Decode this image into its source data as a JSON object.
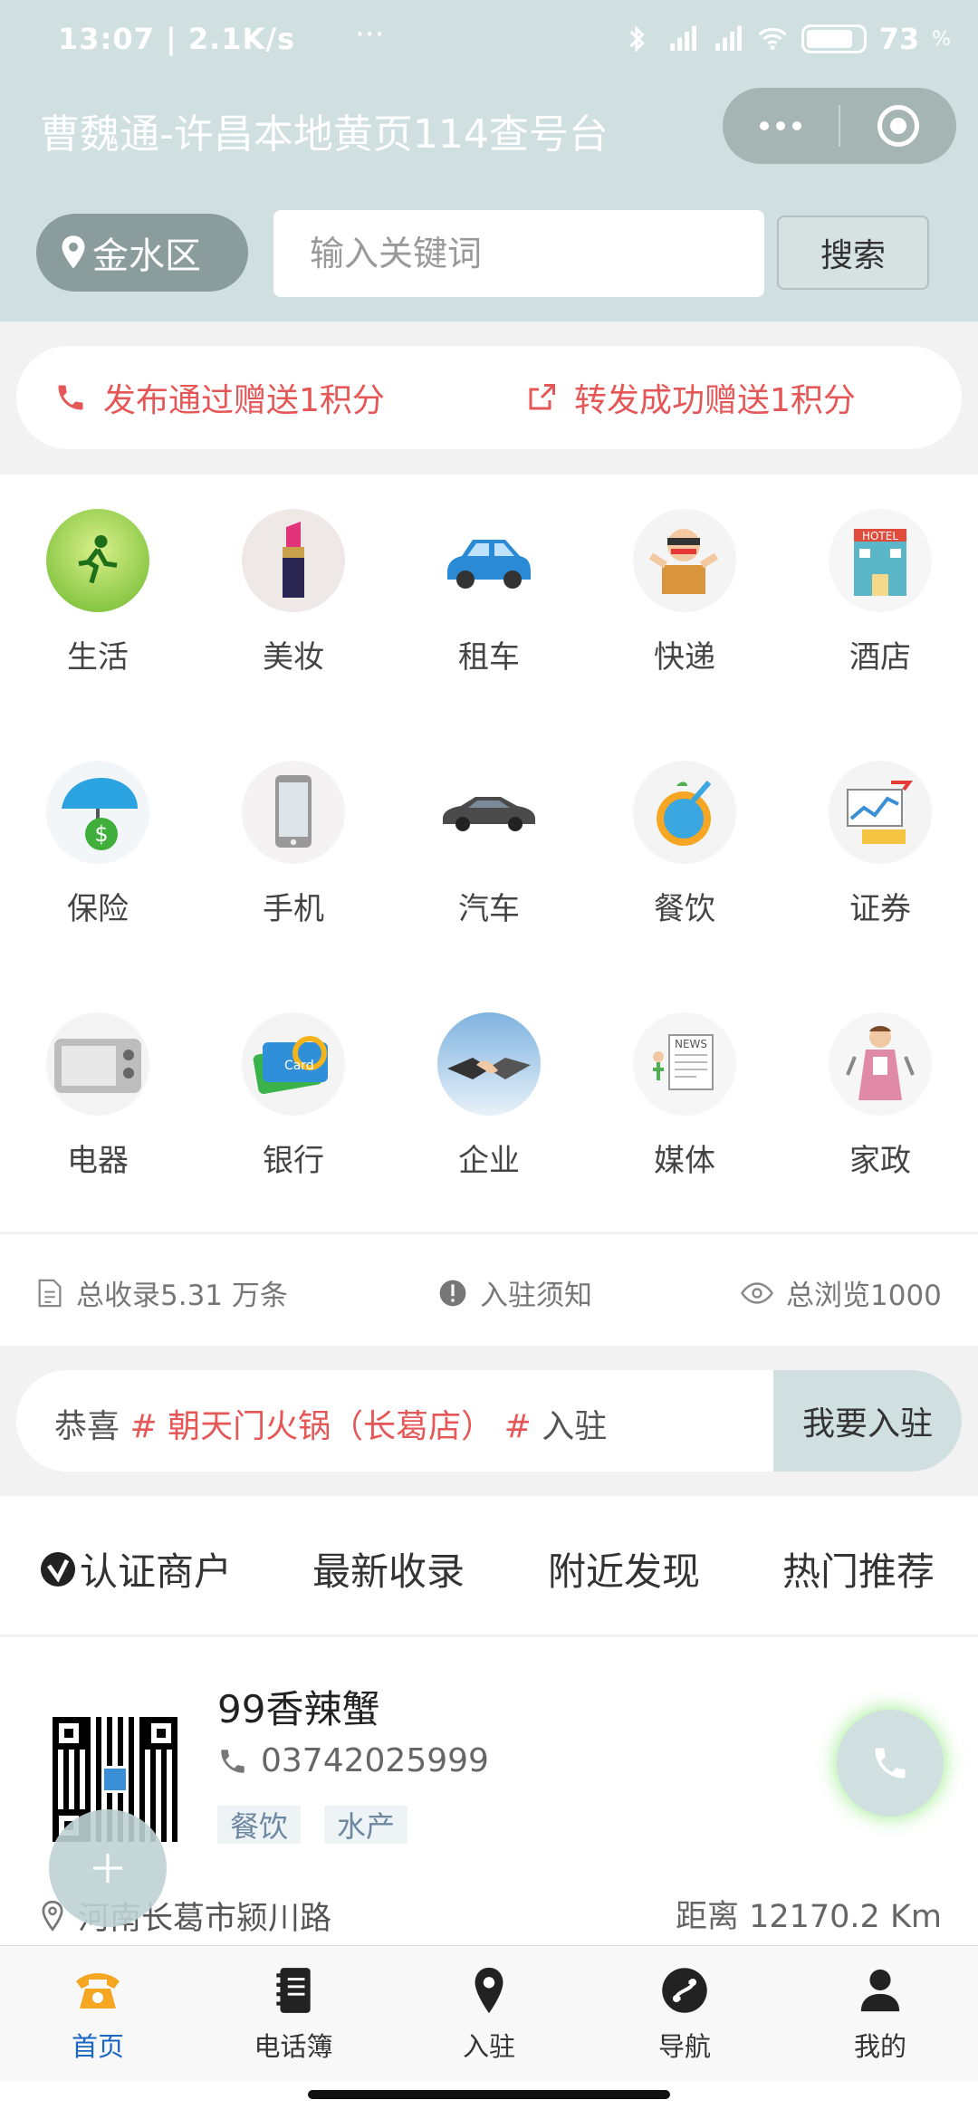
{
  "status_bar": {
    "time": "13:07 | 2.1K/s",
    "extra": "···",
    "battery": "73"
  },
  "header": {
    "title": "曹魏通-许昌本地黄页114查号台"
  },
  "search": {
    "district": "金水区",
    "placeholder": "输入关键词",
    "button": "搜索"
  },
  "promo": {
    "left": "发布通过赠送1积分",
    "right": "转发成功赠送1积分"
  },
  "categories": [
    {
      "label": "生活",
      "icon": "running-person-icon"
    },
    {
      "label": "美妆",
      "icon": "lipstick-icon"
    },
    {
      "label": "租车",
      "icon": "blue-car-icon"
    },
    {
      "label": "快递",
      "icon": "courier-icon"
    },
    {
      "label": "酒店",
      "icon": "hotel-icon"
    },
    {
      "label": "保险",
      "icon": "umbrella-money-icon"
    },
    {
      "label": "手机",
      "icon": "smartphone-icon"
    },
    {
      "label": "汽车",
      "icon": "sports-car-icon"
    },
    {
      "label": "餐饮",
      "icon": "drink-icon"
    },
    {
      "label": "证券",
      "icon": "stock-chart-icon"
    },
    {
      "label": "电器",
      "icon": "microwave-icon"
    },
    {
      "label": "银行",
      "icon": "bank-card-icon"
    },
    {
      "label": "企业",
      "icon": "handshake-icon"
    },
    {
      "label": "媒体",
      "icon": "newspaper-icon"
    },
    {
      "label": "家政",
      "icon": "housekeeper-icon"
    }
  ],
  "stats": {
    "total": "总收录5.31 万条",
    "notice": "入驻须知",
    "views": "总浏览1000"
  },
  "ticker": {
    "prefix": "恭喜",
    "hash1": "#",
    "name": "朝天门火锅（长葛店）",
    "hash2": "#",
    "suffix": "入驻",
    "button": "我要入驻"
  },
  "tabs": [
    "认证商户",
    "最新收录",
    "附近发现",
    "热门推荐"
  ],
  "listing": {
    "name": "99香辣蟹",
    "phone": "03742025999",
    "tags": [
      "餐饮",
      "水产"
    ],
    "address": "河南长葛市颍川路",
    "distance": "距离 12170.2 Km"
  },
  "nav": [
    {
      "label": "首页",
      "icon": "telephone-icon",
      "active": true
    },
    {
      "label": "电话簿",
      "icon": "notebook-icon",
      "active": false
    },
    {
      "label": "入驻",
      "icon": "location-pin-icon",
      "active": false
    },
    {
      "label": "导航",
      "icon": "navigation-icon",
      "active": false
    },
    {
      "label": "我的",
      "icon": "user-icon",
      "active": false
    }
  ],
  "colors": {
    "header_bg": "#d0dfe0",
    "accent_red": "#e55656",
    "nav_active": "#1a66c0",
    "nav_active_icon": "#f5a623"
  }
}
